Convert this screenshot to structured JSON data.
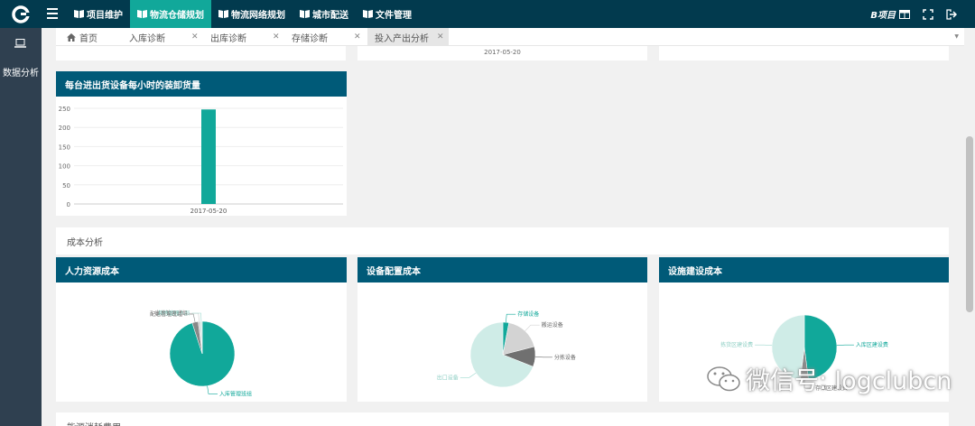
{
  "colors": {
    "topbar": "#023a4e",
    "sidebar": "#2f4050",
    "accent": "#11a89a",
    "card_header": "#005a78"
  },
  "logo_icon": "company-logo",
  "nav": {
    "items": [
      {
        "label": "项目维护",
        "icon": "book-icon",
        "active": false
      },
      {
        "label": "物流仓储规划",
        "icon": "book-icon",
        "active": true
      },
      {
        "label": "物流网络规划",
        "icon": "book-icon",
        "active": false
      },
      {
        "label": "城市配送",
        "icon": "book-icon",
        "active": false
      },
      {
        "label": "文件管理",
        "icon": "book-icon",
        "active": false
      }
    ],
    "project_label": "B项目"
  },
  "sidebar": {
    "label": "数据分析",
    "icon": "laptop-icon"
  },
  "tabs": {
    "home": "首页",
    "items": [
      "入库诊断",
      "出库诊断",
      "存储诊断",
      "投入产出分析"
    ],
    "active": "投入产出分析"
  },
  "top_partial": {
    "date_label": "2017-05-20"
  },
  "unload_chart": {
    "title": "每台进出货设备每小时的装卸货量",
    "chart_data": {
      "type": "bar",
      "categories": [
        "2017-05-20"
      ],
      "values": [
        247
      ],
      "yticks": [
        0,
        50,
        100,
        150,
        200,
        250
      ],
      "ylim": [
        0,
        250
      ],
      "color": "#11a89a"
    }
  },
  "cost_section": {
    "title": "成本分析",
    "charts": [
      {
        "title": "人力资源成本",
        "chart_data": {
          "type": "pie",
          "slices": [
            {
              "label": "入库管理班组",
              "value": 95,
              "color": "#11a89a"
            },
            {
              "label": "配送管理班组",
              "value": 3,
              "color": "#888888"
            },
            {
              "label": "出库管理班组",
              "value": 1,
              "color": "#cccccc"
            },
            {
              "label": "其他管理人员",
              "value": 1,
              "color": "#cfece7"
            }
          ]
        }
      },
      {
        "title": "设备配置成本",
        "chart_data": {
          "type": "pie",
          "slices": [
            {
              "label": "存储设备",
              "value": 3,
              "color": "#11a89a"
            },
            {
              "label": "搬运设备",
              "value": 18,
              "color": "#d3d3d3"
            },
            {
              "label": "分拣设备",
              "value": 10,
              "color": "#707070"
            },
            {
              "label": "出口设备",
              "value": 69,
              "color": "#cfece7"
            }
          ]
        }
      },
      {
        "title": "设施建设成本",
        "chart_data": {
          "type": "pie",
          "slices": [
            {
              "label": "入库区建设费",
              "value": 48,
              "color": "#11a89a"
            },
            {
              "label": "存储区建设费",
              "value": 4,
              "color": "#8a8a8a"
            },
            {
              "label": "拣货区建设费",
              "value": 48,
              "color": "#cfece7"
            }
          ]
        }
      }
    ]
  },
  "next_section": {
    "title": "能源消耗费用"
  },
  "watermark": {
    "text": "微信号: logclubcn",
    "icon": "wechat-icon"
  }
}
